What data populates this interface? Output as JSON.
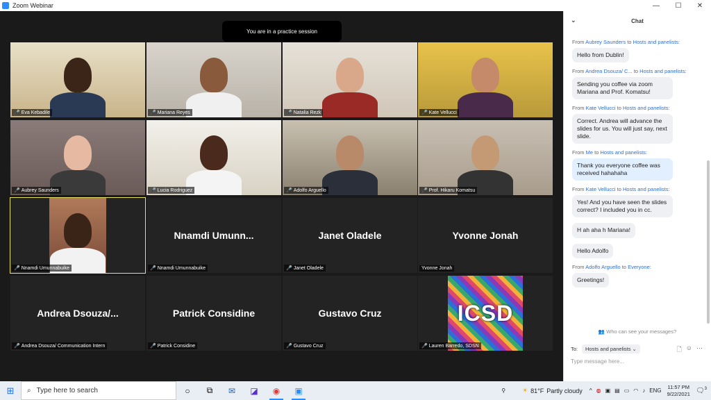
{
  "window": {
    "title": "Zoom Webinar",
    "minimize": "—",
    "maximize": "☐",
    "close": "✕"
  },
  "banner": "You are in a practice session",
  "tiles": [
    {
      "name": "Eva Kebadile"
    },
    {
      "name": "Mariana Reyes"
    },
    {
      "name": "Natalia Rezk"
    },
    {
      "name": "Kate Vellucci"
    },
    {
      "name": "Aubrey Saunders"
    },
    {
      "name": "Lucia Rodriguez"
    },
    {
      "name": "Adolfo Arguello"
    },
    {
      "name": "Prof. Hikaru Komatsu"
    },
    {
      "name": "Nnamdi Umunnabuike"
    },
    {
      "name": "Nnamdi Umunnabuike",
      "big": "Nnamdi  Umunn..."
    },
    {
      "name": "Janet Oladele",
      "big": "Janet Oladele"
    },
    {
      "name": "Yvonne Jonah",
      "big": "Yvonne Jonah"
    },
    {
      "name": "Andrea Dsouza/ Communication Intern",
      "big": "Andrea  Dsouza/..."
    },
    {
      "name": "Patrick Considine",
      "big": "Patrick Considine"
    },
    {
      "name": "Gustavo Cruz",
      "big": "Gustavo Cruz"
    },
    {
      "name": "Lauren Barredo, SDSN",
      "logo": "ICSD"
    }
  ],
  "chat": {
    "title": "Chat",
    "messages": [
      {
        "from": "Aubrey Saunders",
        "to": "Hosts and panelists:",
        "texts": [
          "Hello from Dublin!"
        ]
      },
      {
        "from": "Andrea Dsouza/ C...",
        "to": "Hosts and panelists:",
        "texts": [
          "Sending you coffee via zoom Mariana and Prof. Komatsu!"
        ]
      },
      {
        "from": "Kate Vellucci",
        "to": "Hosts and panelists:",
        "texts": [
          "Correct. Andrea will advance the slides for us. You will just say, next slide."
        ]
      },
      {
        "from": "Me",
        "to": "Hosts and panelists:",
        "texts": [
          "Thank you everyone coffee was received hahahaha"
        ],
        "me": true
      },
      {
        "from": "Kate Vellucci",
        "to": "Hosts and panelists:",
        "texts": [
          "Yes! And you have seen the slides correct? I included you in cc.",
          "H ah aha h Mariana!",
          "Hello Adolfo"
        ]
      },
      {
        "from": "Adolfo Arguello",
        "to": "Everyone:",
        "texts": [
          "Greetings!"
        ]
      }
    ],
    "from_word": "From",
    "to_word": "to",
    "who_can_see": "Who can see your messages?",
    "to_label": "To:",
    "to_value": "Hosts and panelists",
    "input_placeholder": "Type message here..."
  },
  "taskbar": {
    "search_placeholder": "Type here to search",
    "temperature": "81°F",
    "weather": "Partly cloudy",
    "language": "ENG",
    "time": "11:57 PM",
    "date": "9/22/2021",
    "notification_count": "3"
  }
}
